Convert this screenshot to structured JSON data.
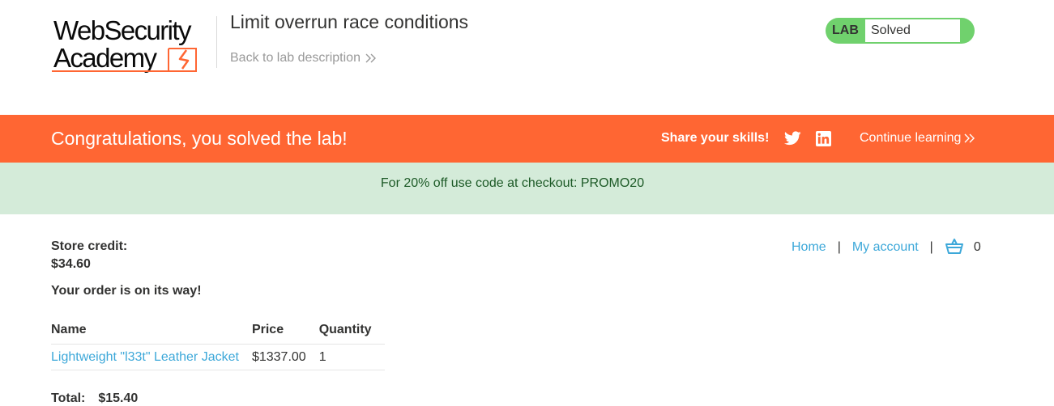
{
  "header": {
    "logo_line1": "WebSecurity",
    "logo_line2": "Academy",
    "lab_title": "Limit overrun race conditions",
    "back_link": "Back to lab description",
    "status_label": "LAB",
    "status_text": "Solved"
  },
  "banner": {
    "message": "Congratulations, you solved the lab!",
    "share_label": "Share your skills!",
    "continue_label": "Continue learning"
  },
  "promo": {
    "text": "For 20% off use code at checkout: PROMO20"
  },
  "nav": {
    "home": "Home",
    "separator": "|",
    "account": "My account",
    "cart_count": "0"
  },
  "account": {
    "credit_label": "Store credit:",
    "credit_value": "$34.60",
    "order_message": "Your order is on its way!"
  },
  "order_table": {
    "headers": [
      "Name",
      "Price",
      "Quantity"
    ],
    "rows": [
      {
        "name": "Lightweight \"l33t\" Leather Jacket",
        "price": "$1337.00",
        "quantity": "1"
      }
    ]
  },
  "total": {
    "label": "Total:",
    "value": "$15.40"
  },
  "colors": {
    "accent_orange": "#ff6633",
    "solved_green": "#70d16d",
    "link_blue": "#3da8d9",
    "promo_bg": "#d4ebd9"
  },
  "icons": [
    "logo-mark-icon",
    "chevron-right-icon",
    "twitter-icon",
    "linkedin-icon",
    "cart-icon"
  ]
}
